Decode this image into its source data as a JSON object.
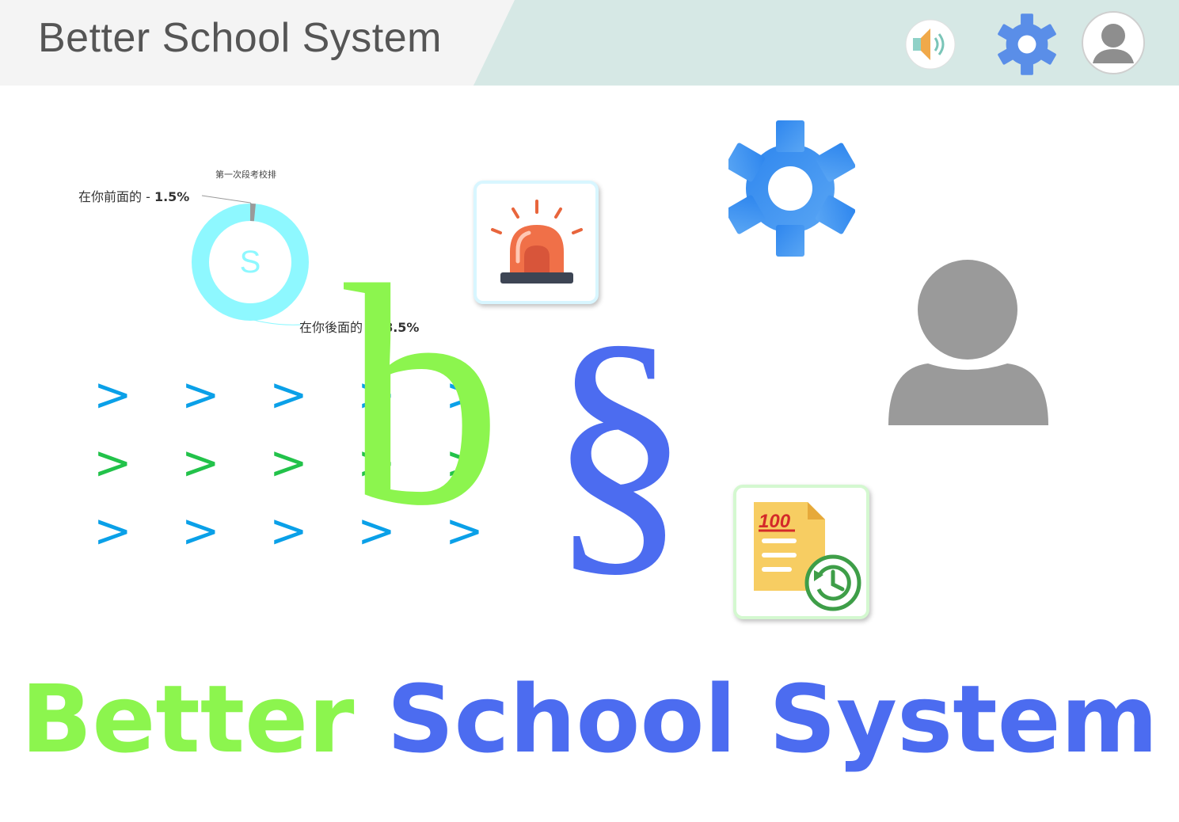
{
  "header": {
    "app_title": "Better School System",
    "sound_icon": "speaker-icon",
    "settings_icon": "gear-icon",
    "profile_icon": "user-avatar-icon"
  },
  "colors": {
    "accent_green": "#8cf54e",
    "accent_blue": "#4c6cf0",
    "chevron_blue": "#0aa0e8",
    "chevron_green": "#22c24a",
    "donut_cyan": "#8ef8ff",
    "gear_blue": "#3c8ff0",
    "avatar_gray": "#9a9a9a"
  },
  "rank_chart": {
    "title": "第一次段考校排",
    "center_letter": "S",
    "ahead_label": "在你前面的 - ",
    "ahead_value": "1.5%",
    "behind_label": "在你後面的 - ",
    "behind_value": "98.5%"
  },
  "chart_data": {
    "type": "pie",
    "title": "第一次段考校排",
    "categories": [
      "在你前面的",
      "在你後面的"
    ],
    "values": [
      1.5,
      98.5
    ],
    "colors": [
      "#9a9a9a",
      "#8ef8ff"
    ]
  },
  "tiles": [
    {
      "name": "alarm-tile",
      "icon": "siren-icon"
    },
    {
      "name": "settings-tile",
      "icon": "gear-icon"
    },
    {
      "name": "profile-tile",
      "icon": "user-icon"
    },
    {
      "name": "score-history-tile",
      "icon": "score-history-icon"
    }
  ],
  "chevrons": {
    "row1": "> > > > >",
    "row2": "> > > > >",
    "row3": "> > > > >"
  },
  "logo": {
    "letter_b": "b",
    "letter_s": "§"
  },
  "banner": {
    "word1": "Better",
    "word2": "School System"
  }
}
